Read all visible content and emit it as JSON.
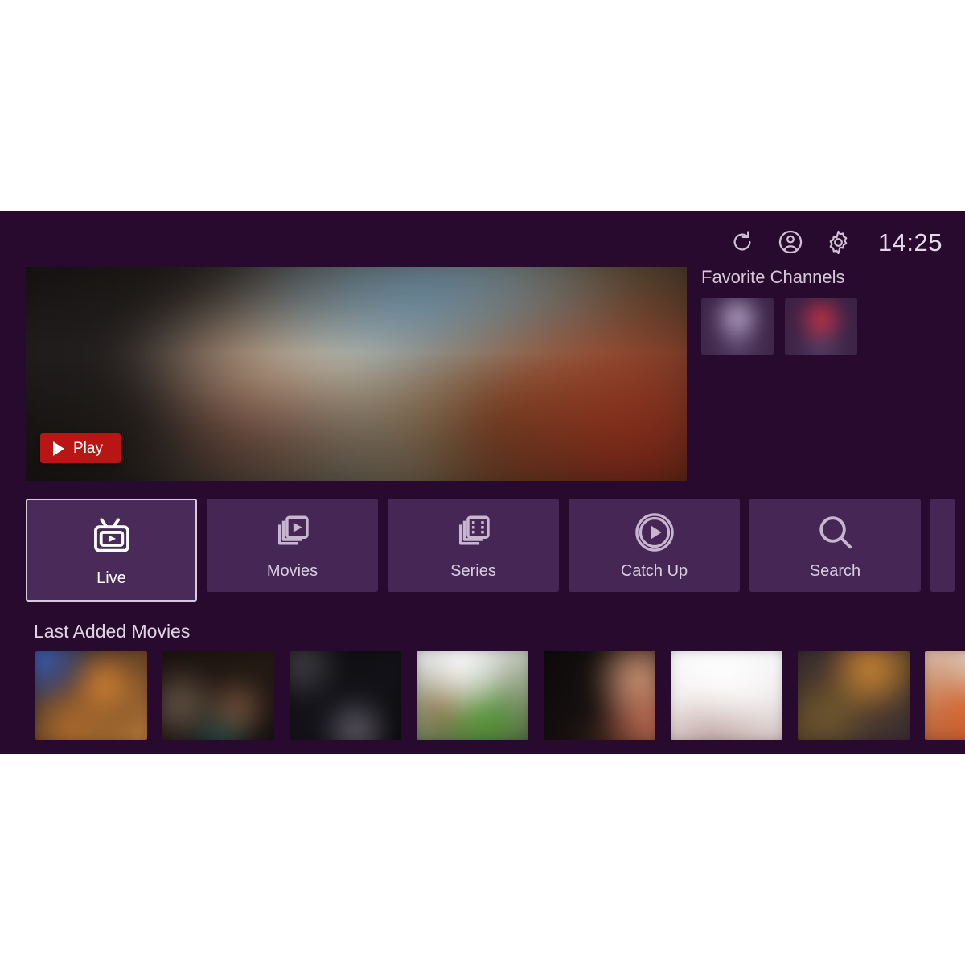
{
  "app": {
    "background_color": "#290a2f",
    "tile_color": "#452654",
    "accent_color": "#b81515",
    "highlight_border_color": "#d8cbe0"
  },
  "status_bar": {
    "refresh_label": "refresh-icon",
    "account_label": "account-icon",
    "settings_label": "gear-icon",
    "time": "14:25"
  },
  "hero": {
    "play_label": "Play"
  },
  "favorites": {
    "title": "Favorite Channels",
    "channels": [
      {
        "name": "favorite-channel-1"
      },
      {
        "name": "favorite-channel-2"
      }
    ]
  },
  "nav": {
    "items": [
      {
        "label": "Live",
        "icon": "tv-icon",
        "selected": true
      },
      {
        "label": "Movies",
        "icon": "movies-stack-icon",
        "selected": false
      },
      {
        "label": "Series",
        "icon": "series-stack-icon",
        "selected": false
      },
      {
        "label": "Catch Up",
        "icon": "circle-play-icon",
        "selected": false
      },
      {
        "label": "Search",
        "icon": "search-icon",
        "selected": false
      },
      {
        "label": "",
        "icon": "",
        "selected": false
      }
    ]
  },
  "last_added": {
    "title": "Last Added Movies",
    "items": [
      {
        "name": "movie-poster-1"
      },
      {
        "name": "movie-poster-2"
      },
      {
        "name": "movie-poster-3"
      },
      {
        "name": "movie-poster-4"
      },
      {
        "name": "movie-poster-5"
      },
      {
        "name": "movie-poster-6"
      },
      {
        "name": "movie-poster-7"
      },
      {
        "name": "movie-poster-8"
      }
    ]
  }
}
